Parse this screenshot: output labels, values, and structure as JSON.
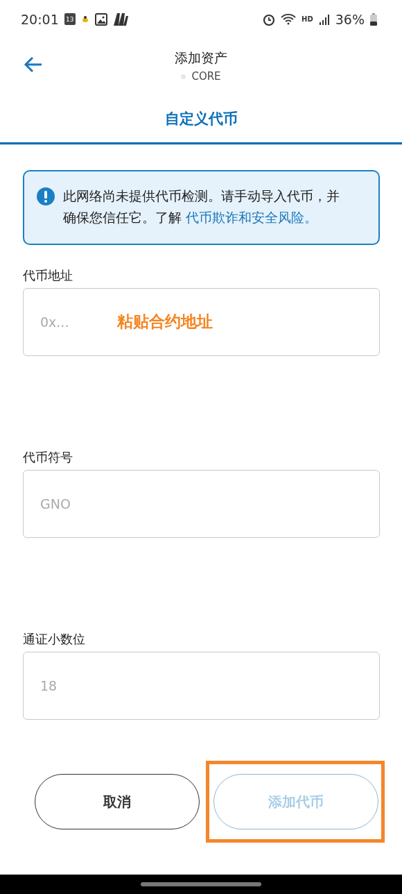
{
  "status_bar": {
    "time": "20:01",
    "calendar_day": "13",
    "battery": "36%",
    "network": "HD"
  },
  "header": {
    "title": "添加资产",
    "subtitle": "CORE"
  },
  "tabs": [
    {
      "label": "自定义代币",
      "selected": true
    }
  ],
  "alert": {
    "text": "此网络尚未提供代币检测。请手动导入代币，并确保您信任它。了解 ",
    "link": "代币欺诈和安全风险。"
  },
  "fields": [
    {
      "label": "代币地址",
      "placeholder": "0x...",
      "annotation": "粘贴合约地址"
    },
    {
      "label": "代币符号",
      "placeholder": "GNO"
    },
    {
      "label": "通证小数位",
      "placeholder": "18"
    }
  ],
  "buttons": [
    {
      "label": "取消",
      "kind": "secondary",
      "disabled": false,
      "highlighted": false
    },
    {
      "label": "添加代币",
      "kind": "primary",
      "disabled": true,
      "highlighted": true
    }
  ]
}
